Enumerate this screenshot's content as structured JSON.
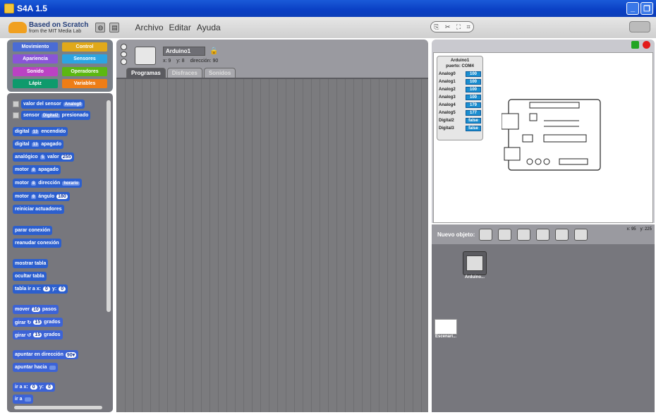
{
  "window": {
    "title": "S4A 1.5"
  },
  "menubar": {
    "logo_title": "Based on Scratch",
    "logo_subtitle": "from the MIT Media Lab",
    "menus": [
      "Archivo",
      "Editar",
      "Ayuda"
    ]
  },
  "categories": [
    {
      "label": "Movimiento",
      "color": "#4a6cd4"
    },
    {
      "label": "Control",
      "color": "#e1a91a"
    },
    {
      "label": "Apariencia",
      "color": "#8a55d7"
    },
    {
      "label": "Sensores",
      "color": "#2ca5e2"
    },
    {
      "label": "Sonido",
      "color": "#bb42c3"
    },
    {
      "label": "Operadores",
      "color": "#5cb712"
    },
    {
      "label": "Lápiz",
      "color": "#0e9a6c"
    },
    {
      "label": "Variables",
      "color": "#ee7d16"
    }
  ],
  "palette": {
    "sensor_value": {
      "label": "valor del sensor",
      "slot": "Analog0"
    },
    "sensor_pressed": {
      "label": "sensor",
      "slot": "Digital2",
      "suffix": "presionado"
    },
    "digital_on": {
      "pre": "digital",
      "slot": "13",
      "suffix": "encendido"
    },
    "digital_off": {
      "pre": "digital",
      "slot": "13",
      "suffix": "apagado"
    },
    "analog": {
      "pre": "analógico",
      "slot": "5",
      "suffix": "valor",
      "num": "255"
    },
    "motor_off": {
      "pre": "motor",
      "slot": "8",
      "suffix": "apagado"
    },
    "motor_dir": {
      "pre": "motor",
      "slot": "8",
      "suffix": "dirección",
      "slot2": "horario"
    },
    "motor_angle": {
      "pre": "motor",
      "slot": "8",
      "suffix": "ángulo",
      "num": "180"
    },
    "init_actuators": "reiniciar actuadores",
    "stop_conn": "parar conexión",
    "resume_conn": "reanudar conexión",
    "show_board": "mostrar tabla",
    "hide_board": "ocultar tabla",
    "board_move": {
      "pre": "tabla ir a x:",
      "num1": "0",
      "mid": "y:",
      "num2": "0"
    },
    "move": {
      "pre": "mover",
      "num": "10",
      "suffix": "pasos"
    },
    "turn_right": {
      "pre": "girar ↻",
      "num": "15",
      "suffix": "grados"
    },
    "turn_left": {
      "pre": "girar ↺",
      "num": "15",
      "suffix": "grados"
    },
    "point_dir": {
      "pre": "apuntar en dirección",
      "num": "90▾"
    },
    "point_towards": "apuntar hacia",
    "goto_xy": {
      "pre": "ir a x:",
      "num1": "0",
      "mid": "y:",
      "num2": "0"
    },
    "goto": "ir a"
  },
  "sprite": {
    "name": "Arduino1",
    "x": "x: 9",
    "y": "y: 8",
    "direction": "dirección: 90"
  },
  "tabs": [
    "Programas",
    "Disfraces",
    "Sonidos"
  ],
  "sensor_board": {
    "title_line1": "Arduino1",
    "title_line2": "puerto: COM4",
    "rows": [
      {
        "name": "Analog0",
        "value": "100"
      },
      {
        "name": "Analog1",
        "value": "100"
      },
      {
        "name": "Analog2",
        "value": "100"
      },
      {
        "name": "Analog3",
        "value": "100"
      },
      {
        "name": "Analog4",
        "value": "179"
      },
      {
        "name": "Analog5",
        "value": "177"
      },
      {
        "name": "Digital2",
        "value": "false"
      },
      {
        "name": "Digital3",
        "value": "false"
      }
    ]
  },
  "stage_bottom": {
    "new_object": "Nuevo objeto:",
    "mouse_x": "x: 95",
    "mouse_y": "y: 225"
  },
  "sprites_list": {
    "sprite_label": "Arduino...",
    "stage_label": "Escenari..."
  }
}
